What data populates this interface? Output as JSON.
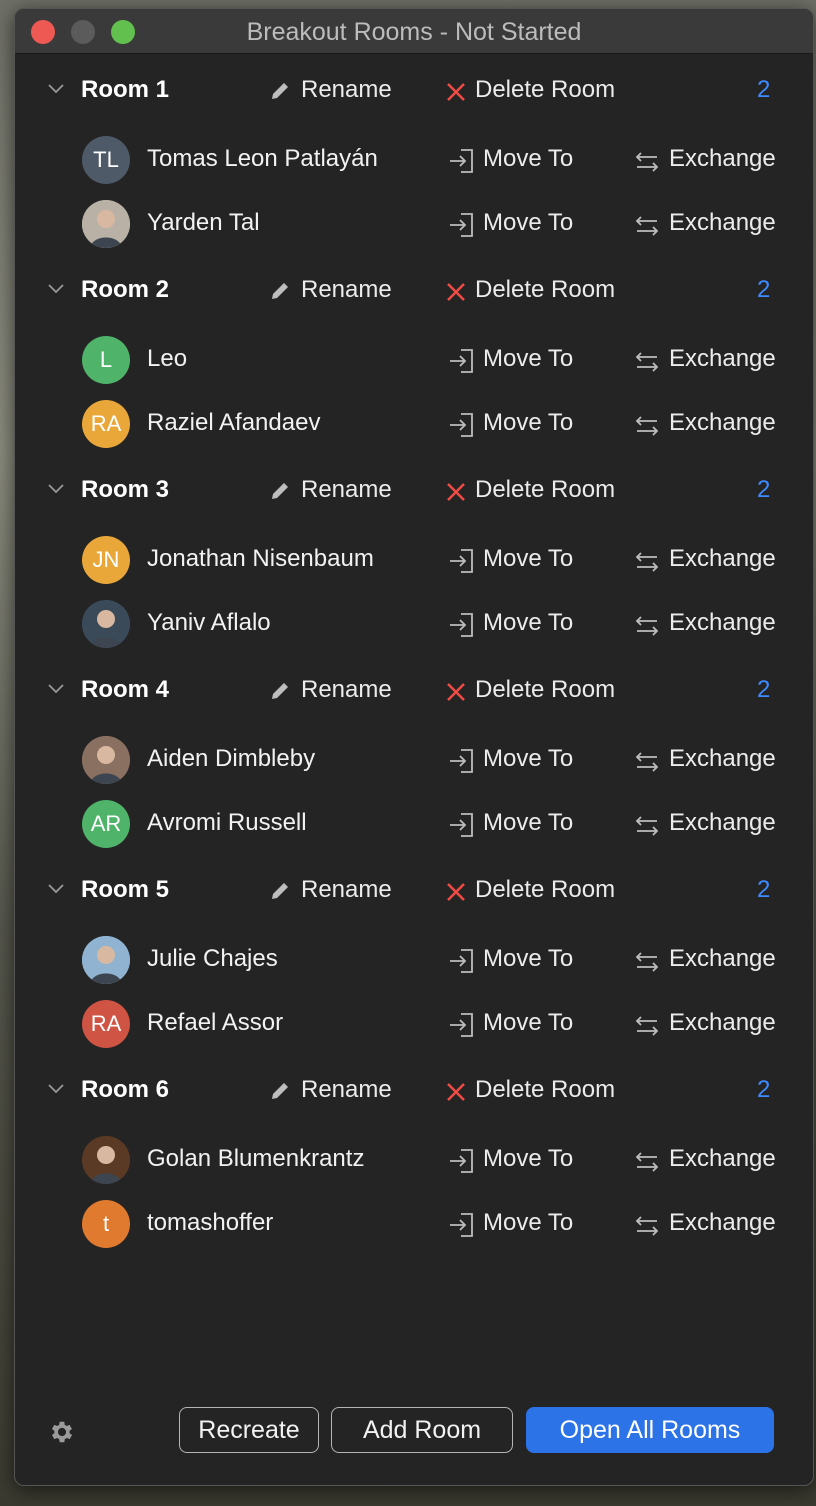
{
  "window": {
    "title": "Breakout Rooms - Not Started"
  },
  "rooms": [
    {
      "name": "Room 1",
      "rename_label": "Rename",
      "delete_label": "Delete Room",
      "count": "2",
      "participants": [
        {
          "name": "Tomas Leon Patlayán",
          "initials": "TL",
          "avatar_color": "#4e5a68",
          "photo": false
        },
        {
          "name": "Yarden Tal",
          "initials": "",
          "avatar_color": "#b9b1a6",
          "photo": true
        }
      ]
    },
    {
      "name": "Room 2",
      "rename_label": "Rename",
      "delete_label": "Delete Room",
      "count": "2",
      "participants": [
        {
          "name": "Leo",
          "initials": "L",
          "avatar_color": "#4fb36a",
          "photo": false
        },
        {
          "name": "Raziel Afandaev",
          "initials": "RA",
          "avatar_color": "#e9a73a",
          "photo": false
        }
      ]
    },
    {
      "name": "Room 3",
      "rename_label": "Rename",
      "delete_label": "Delete Room",
      "count": "2",
      "participants": [
        {
          "name": "Jonathan Nisenbaum",
          "initials": "JN",
          "avatar_color": "#e9a73a",
          "photo": false
        },
        {
          "name": "Yaniv Aflalo",
          "initials": "",
          "avatar_color": "#3a4a58",
          "photo": true
        }
      ]
    },
    {
      "name": "Room 4",
      "rename_label": "Rename",
      "delete_label": "Delete Room",
      "count": "2",
      "participants": [
        {
          "name": "Aiden Dimbleby",
          "initials": "",
          "avatar_color": "#8a7060",
          "photo": true
        },
        {
          "name": "Avromi Russell",
          "initials": "AR",
          "avatar_color": "#4fb36a",
          "photo": false
        }
      ]
    },
    {
      "name": "Room 5",
      "rename_label": "Rename",
      "delete_label": "Delete Room",
      "count": "2",
      "participants": [
        {
          "name": "Julie Chajes",
          "initials": "",
          "avatar_color": "#8fb3d0",
          "photo": true
        },
        {
          "name": "Refael Assor",
          "initials": "RA",
          "avatar_color": "#cf5444",
          "photo": false
        }
      ]
    },
    {
      "name": "Room 6",
      "rename_label": "Rename",
      "delete_label": "Delete Room",
      "count": "2",
      "participants": [
        {
          "name": "Golan Blumenkrantz",
          "initials": "",
          "avatar_color": "#5a3a25",
          "photo": true
        },
        {
          "name": "tomashoffer",
          "initials": "t",
          "avatar_color": "#e07a2e",
          "photo": false
        }
      ]
    }
  ],
  "actions": {
    "move_to_label": "Move To",
    "exchange_label": "Exchange"
  },
  "footer": {
    "settings_icon": "gear-icon",
    "recreate_label": "Recreate",
    "add_room_label": "Add Room",
    "open_all_label": "Open All Rooms"
  },
  "colors": {
    "accent": "#2c73e8",
    "count": "#3d8bff",
    "delete_x": "#ee4b45",
    "background": "#242424"
  }
}
